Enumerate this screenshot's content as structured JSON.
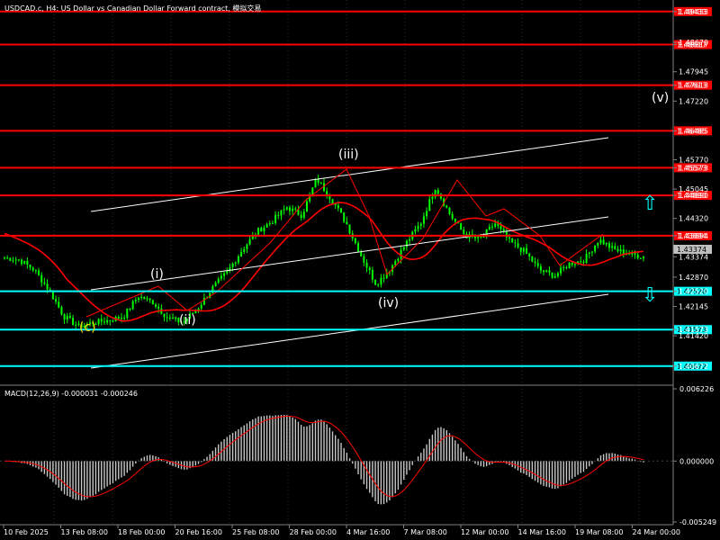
{
  "title": "USDCAD.c, H4: US Dollar vs Canadian Dollar Forward contract, 模拟交易",
  "colors": {
    "background": "#000000",
    "grid": "#2a2a2a",
    "candle": "#00ff00",
    "red_level": "#ff0000",
    "cyan_level": "#00ffff",
    "ma": "#ff0000",
    "channel": "#ffffff",
    "wave_line": "#ff0000",
    "macd_hist": "#c8c8c8",
    "macd_signal": "#ff0000",
    "current_price_bg": "#c0c0c0",
    "wave_c_label": "#ffd700"
  },
  "price_axis": {
    "labels": [
      "1.49433",
      "1.48670",
      "1.48617",
      "1.47945",
      "1.47613",
      "1.47220",
      "1.46485",
      "1.45770",
      "1.45573",
      "1.45045",
      "1.44890",
      "1.44320",
      "1.43894",
      "1.43595",
      "1.43374",
      "1.42870",
      "1.42520",
      "1.42145",
      "1.41573",
      "1.41420",
      "1.40672"
    ],
    "range": [
      1.406,
      1.4954
    ]
  },
  "levels": {
    "red": [
      "1.49433",
      "1.48617",
      "1.47613",
      "1.46485",
      "1.45573",
      "1.44890",
      "1.43894"
    ],
    "cyan": [
      "1.42520",
      "1.41573",
      "1.40672"
    ]
  },
  "current_price": "1.43374",
  "waves": {
    "c": "(c)",
    "i": "(i)",
    "ii": "(ii)",
    "iii": "(iii)",
    "iv": "(iv)",
    "v": "(v)"
  },
  "arrows": {
    "up": "⇧",
    "down": "⇩"
  },
  "macd": {
    "label": "MACD(12,26,9) -0.000031 -0.000246",
    "axis_labels": [
      "0.006226",
      "0.000000",
      "-0.005249"
    ],
    "range": [
      -0.005249,
      0.006226
    ]
  },
  "time_axis": [
    "10 Feb 2025",
    "13 Feb 08:00",
    "18 Feb 00:00",
    "20 Feb 16:00",
    "25 Feb 08:00",
    "28 Feb 00:00",
    "4 Mar 16:00",
    "7 Mar 08:00",
    "12 Mar 00:00",
    "14 Mar 16:00",
    "19 Mar 08:00",
    "24 Mar 00:00"
  ],
  "chart_data": {
    "type": "candlestick",
    "title": "USDCAD.c, H4: US Dollar vs Canadian Dollar Forward contract",
    "indicators": [
      "Moving Average",
      "MACD(12,26,9)",
      "Elliott wave labels",
      "Trend channel"
    ],
    "price_close_path": [
      [
        "10 Feb 2025",
        1.4335
      ],
      [
        "11 Feb",
        1.433
      ],
      [
        "12 Feb",
        1.4305
      ],
      [
        "12 Feb",
        1.4255
      ],
      [
        "13 Feb 08:00",
        1.419
      ],
      [
        "13 Feb",
        1.4165
      ],
      [
        "14 Feb",
        1.4175
      ],
      [
        "17 Feb",
        1.418
      ],
      [
        "18 Feb 00:00",
        1.419
      ],
      [
        "19 Feb",
        1.424
      ],
      [
        "19 Feb",
        1.4225
      ],
      [
        "20 Feb",
        1.4185
      ],
      [
        "20 Feb 16:00",
        1.4175
      ],
      [
        "21 Feb",
        1.421
      ],
      [
        "24 Feb",
        1.426
      ],
      [
        "25 Feb 08:00",
        1.43
      ],
      [
        "26 Feb",
        1.4355
      ],
      [
        "27 Feb",
        1.44
      ],
      [
        "28 Feb 00:00",
        1.4425
      ],
      [
        "3 Mar",
        1.446
      ],
      [
        "3 Mar",
        1.444
      ],
      [
        "4 Mar",
        1.453
      ],
      [
        "4 Mar 16:00",
        1.448
      ],
      [
        "5 Mar",
        1.442
      ],
      [
        "6 Mar",
        1.434
      ],
      [
        "6 Mar",
        1.427
      ],
      [
        "7 Mar 08:00",
        1.431
      ],
      [
        "10 Mar",
        1.437
      ],
      [
        "11 Mar",
        1.442
      ],
      [
        "11 Mar",
        1.451
      ],
      [
        "12 Mar 00:00",
        1.444
      ],
      [
        "12 Mar",
        1.439
      ],
      [
        "13 Mar",
        1.438
      ],
      [
        "13 Mar",
        1.442
      ],
      [
        "14 Mar 16:00",
        1.4375
      ],
      [
        "17 Mar",
        1.435
      ],
      [
        "17 Mar",
        1.4305
      ],
      [
        "18 Mar",
        1.429
      ],
      [
        "18 Mar",
        1.432
      ],
      [
        "19 Mar 08:00",
        1.433
      ],
      [
        "20 Mar",
        1.438
      ],
      [
        "20 Mar",
        1.4355
      ],
      [
        "21 Mar",
        1.4345
      ],
      [
        "24 Mar 00:00",
        1.4337
      ]
    ]
  }
}
